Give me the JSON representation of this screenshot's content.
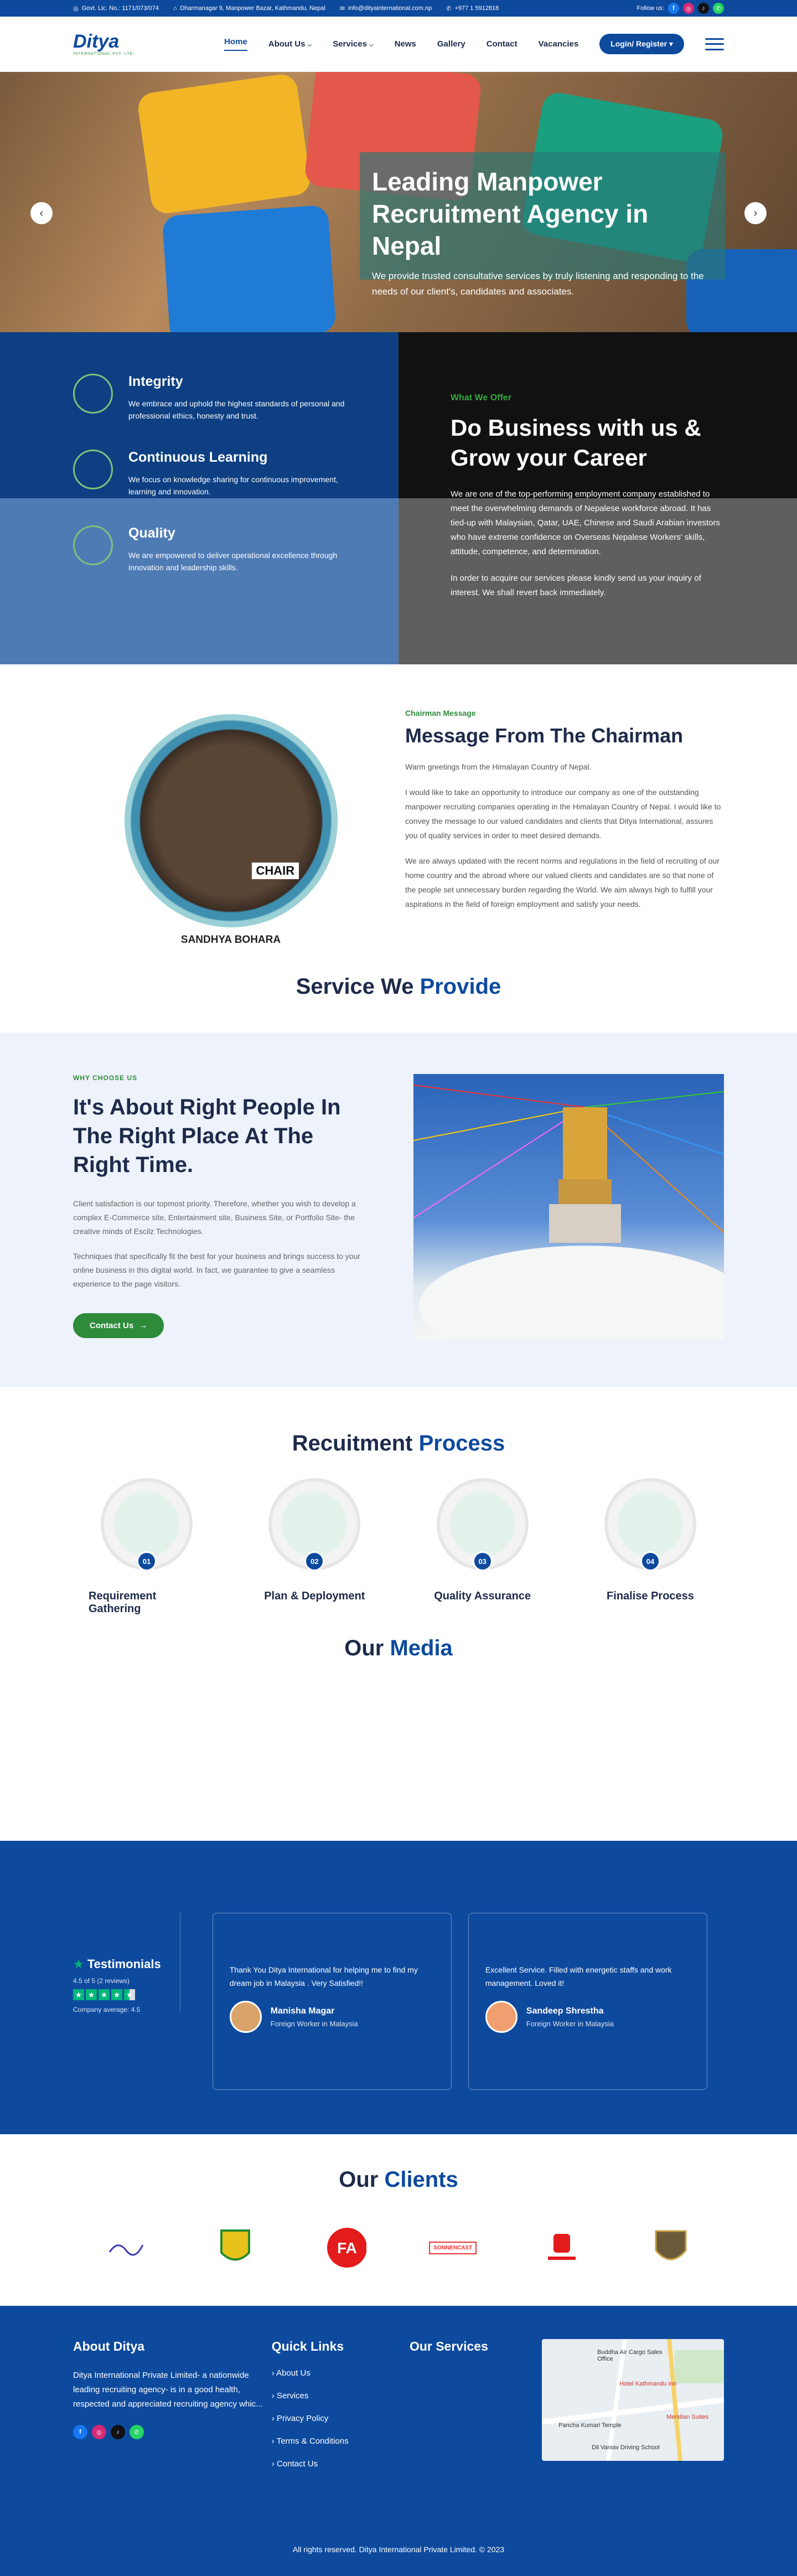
{
  "topbar": {
    "license": "Govt. Lic. No.: 1171/073/074",
    "address": "Dharmanagar 9, Manpower Bazar, Kathmandu, Nepal",
    "email": "info@dityainternational.com.np",
    "phone": "+977 1 5912818",
    "follow_label": "Follow us:"
  },
  "header": {
    "logo_text": "Ditya",
    "logo_sub": "INTERNATIONAL PVT. LTD.",
    "nav": [
      "Home",
      "About Us",
      "Services",
      "News",
      "Gallery",
      "Contact",
      "Vacancies"
    ],
    "login_label": "Login/ Register"
  },
  "hero": {
    "title": "Leading Manpower Recruitment Agency in Nepal",
    "subtitle": "We provide trusted consultative services by truly listening and responding to the needs of our client's, candidates and associates."
  },
  "values": [
    {
      "title": "Integrity",
      "text": "We embrace and uphold the highest standards of personal and professional ethics, honesty and trust."
    },
    {
      "title": "Continuous Learning",
      "text": "We focus on knowledge sharing for continuous improvement, learning and innovation."
    },
    {
      "title": "Quality",
      "text": "We are empowered to deliver operational excellence through innovation and leadership skills."
    }
  ],
  "offer": {
    "tag": "What We Offer",
    "title": "Do Business with us & Grow your Career",
    "p1": "We are one of the top-performing employment company established to meet the overwhelming demands of Nepalese workforce abroad. It has tied-up with Malaysian, Qatar, UAE, Chinese and Saudi Arabian investors who have extreme confidence on Overseas Nepalese Workers' skills, attitude, competence, and determination.",
    "p2": "In order to acquire our services please kindly send us your inquiry of interest. We shall revert back immediately."
  },
  "chairman": {
    "tag": "Chairman Message",
    "title": "Message From The Chairman",
    "greeting": "Warm greetings from the Himalayan Country of Nepal.",
    "p1": "I would like to take an opportunity to introduce our company as one of the outstanding manpower recruiting companies operating in the Himalayan Country of Nepal. I would like to convey the message to our valued candidates and clients that Ditya International, assures you of quality services in order to meet desired demands.",
    "p2": "We are always updated with the recent norms and regulations in the field of recruiting of our home country and the abroad where our valued clients and candidates are so that none of the people set unnecessary burden regarding the World. We aim always high to fulfill your aspirations in the field of foreign employment and satisfy your needs.",
    "name": "SANDHYA BOHARA",
    "chair_sign": "CHAIR"
  },
  "services_title": {
    "a": "Service We ",
    "b": "Provide"
  },
  "why": {
    "tag": "WHY CHOOSE US",
    "title": "It's About Right People In The Right Place At The Right Time.",
    "p1": "Client satisfaction is our topmost priority. Therefore, whether you wish to develop a complex E-Commerce site, Entertainment site, Business Site, or Portfolio Site- the creative minds of Escilz Technologies.",
    "p2": "Techniques that specifically fit the best for your business and brings success to your online business in this digital world. In fact, we guarantee to give a seamless experience to the page visitors.",
    "button": "Contact Us"
  },
  "process": {
    "title_a": "Recuitment ",
    "title_b": "Process",
    "steps": [
      {
        "num": "01",
        "label": "Requirement Gathering"
      },
      {
        "num": "02",
        "label": "Plan & Deployment"
      },
      {
        "num": "03",
        "label": "Quality Assurance"
      },
      {
        "num": "04",
        "label": "Finalise Process"
      }
    ]
  },
  "media": {
    "title_a": "Our ",
    "title_b": "Media"
  },
  "testimonials": {
    "title": "Testimonials",
    "rating": "4.5 of 5 (2 reviews)",
    "average": "Company average: 4.5",
    "items": [
      {
        "text": "Thank You Ditya International for helping me to find my dream job in Malaysia . Very Satisfied!!",
        "name": "Manisha Magar",
        "role": "Foreign Worker in Malaysia"
      },
      {
        "text": "Excellent Service. Filled with energetic staffs and work management. Loved it!",
        "name": "Sandeep Shrestha",
        "role": "Foreign Worker in Malaysia"
      }
    ]
  },
  "clients": {
    "title_a": "Our ",
    "title_b": "Clients",
    "logo_text": "SONNENCAST"
  },
  "footer": {
    "about_title": "About Ditya",
    "about_text": "Ditya International Private Limited- a nationwide leading recruiting agency- is in a good health, respected and appreciated recruiting agency whic...",
    "links_title": "Quick Links",
    "links": [
      "About Us",
      "Services",
      "Privacy Policy",
      "Terms & Conditions",
      "Contact Us"
    ],
    "services_title": "Our Services",
    "map_labels": [
      "Buddha Air Cargo Sales Office",
      "Hotel Kathmandu Inn",
      "Pancha Kumari Temple",
      "Meridian Suites",
      "Dil Vaniav Driving School"
    ],
    "copyright": "All rights reserved. Ditya International Private Limited. © 2023"
  }
}
